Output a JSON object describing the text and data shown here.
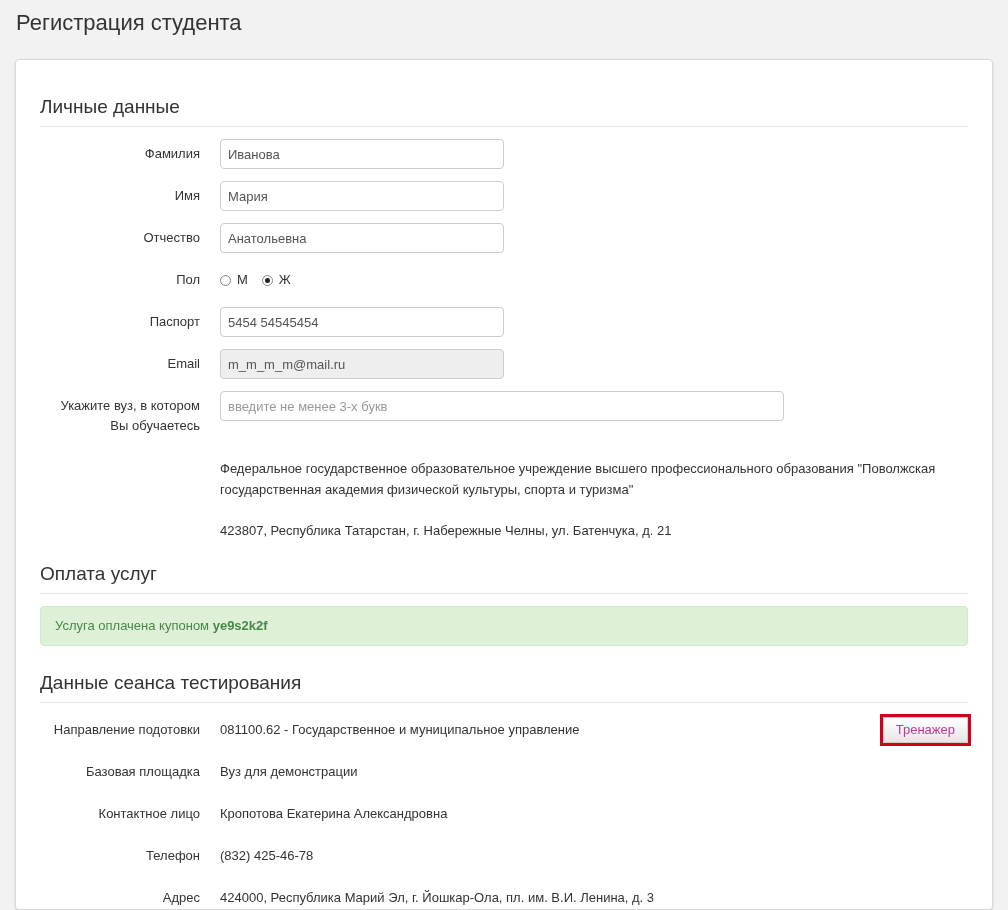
{
  "page_title": "Регистрация студента",
  "personal": {
    "heading": "Личные данные",
    "fields": [
      {
        "kind": "text",
        "label": "Фамилия",
        "value": "Иванова",
        "disabled": false
      },
      {
        "kind": "text",
        "label": "Имя",
        "value": "Мария",
        "disabled": false
      },
      {
        "kind": "text",
        "label": "Отчество",
        "value": "Анатольевна",
        "disabled": false
      },
      {
        "kind": "radio",
        "label": "Пол",
        "options": [
          {
            "label": "М",
            "selected": false
          },
          {
            "label": "Ж",
            "selected": true
          }
        ]
      },
      {
        "kind": "text",
        "label": "Паспорт",
        "value": "5454 54545454",
        "disabled": false
      },
      {
        "kind": "text",
        "label": "Email",
        "value": "m_m_m_m@mail.ru",
        "disabled": true
      },
      {
        "kind": "search",
        "label": "Укажите вуз, в котором Вы обучаетесь",
        "placeholder": "введите не менее 3-х букв"
      }
    ],
    "university": {
      "name": "Федеральное государственное образовательное учреждение высшего профессионального образования \"Поволжская государственная академия физической культуры, спорта и туризма\"",
      "address": "423807, Республика Татарстан, г. Набережные Челны, ул. Батенчука, д. 21"
    }
  },
  "payment": {
    "heading": "Оплата услуг",
    "message": "Услуга оплачена купоном **ye9s2k2f**"
  },
  "session": {
    "heading": "Данные сеанса тестирования",
    "rows": [
      {
        "label": "Направление подотовки",
        "value": "081100.62 - Государственное и муниципальное управление"
      },
      {
        "label": "Базовая площадка",
        "value": "Вуз для демонстрации"
      },
      {
        "label": "Контактное лицо",
        "value": "Кропотова Екатерина Александровна"
      },
      {
        "label": "Телефон",
        "value": "(832) 425-46-78"
      },
      {
        "label": "Адрес",
        "value": "424000, Республика Марий Эл, г. Йошкар-Ола, пл. им. В.И. Ленина, д. 3"
      }
    ],
    "button": {
      "label": "Тренажер",
      "highlighted": true
    }
  }
}
